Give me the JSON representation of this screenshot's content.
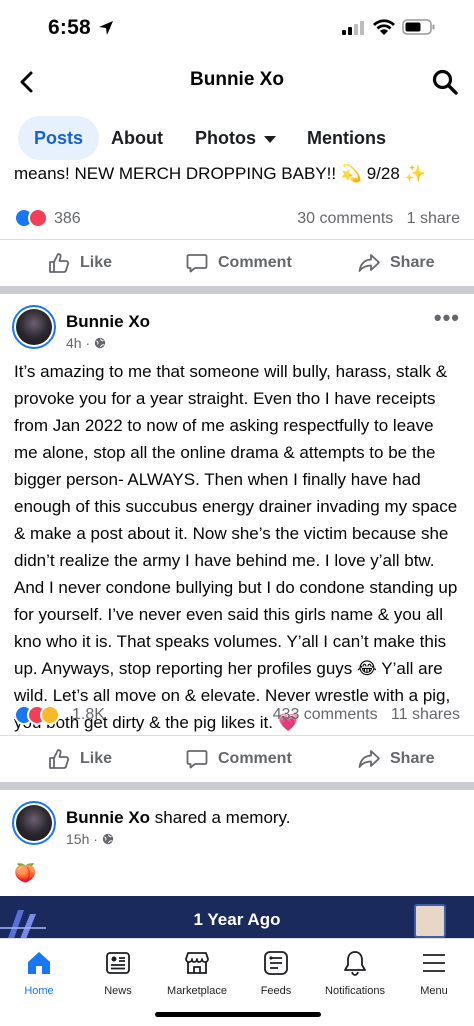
{
  "status_bar": {
    "time": "6:58"
  },
  "header": {
    "title": "Bunnie Xo"
  },
  "tabs": [
    {
      "label": "Posts"
    },
    {
      "label": "About"
    },
    {
      "label": "Photos"
    },
    {
      "label": "Mentions"
    }
  ],
  "post1": {
    "text_tail": "means! NEW MERCH DROPPING BABY!! 💫 9/28 ✨",
    "reaction_count": "386",
    "comments": "30 comments",
    "shares": "1 share"
  },
  "actions": {
    "like": "Like",
    "comment": "Comment",
    "share": "Share"
  },
  "post2": {
    "author": "Bunnie Xo",
    "time": "4h · ",
    "lines": [
      "It’s amazing to me that someone will bully, harass, stalk &",
      "provoke you for a year straight. Even tho I have receipts",
      "from Jan 2022 to now of me asking respectfully to leave",
      "me alone, stop all the online drama & attempts to be the",
      "bigger person- ALWAYS. Then when I finally have had",
      "enough of this succubus energy drainer invading my space",
      "& make a post about it. Now she’s the victim because she",
      "didn’t realize the army I have behind me. I love y’all btw.",
      "And I never condone bullying but I do condone standing up",
      "for yourself. I’ve never even said this girls name & you all",
      "kno who it is. That speaks volumes. Y’all I can’t make this",
      "up. Anyways, stop reporting her profiles guys 😂 Y’all are",
      "wild. Let’s all move on & elevate. Never wrestle with a pig,",
      "you both get dirty & the pig likes it. 💗"
    ],
    "reaction_count": "1.8K",
    "comments": "433 comments",
    "shares": "11 shares"
  },
  "post3": {
    "author": "Bunnie Xo",
    "action": " shared a memory.",
    "time": "15h · ",
    "emoji": "🍑",
    "memory_label": "1 Year Ago"
  },
  "tabbar": [
    {
      "label": "Home",
      "icon": "home-icon",
      "active": true
    },
    {
      "label": "News",
      "icon": "news-icon"
    },
    {
      "label": "Marketplace",
      "icon": "marketplace-icon"
    },
    {
      "label": "Feeds",
      "icon": "feeds-icon"
    },
    {
      "label": "Notifications",
      "icon": "bell-icon"
    },
    {
      "label": "Menu",
      "icon": "menu-icon"
    }
  ],
  "colors": {
    "accent": "#1877f2",
    "tab_active_bg": "#e7f0fd",
    "separator": "#c9ccd1",
    "memory_bg": "#1b2a5c"
  }
}
